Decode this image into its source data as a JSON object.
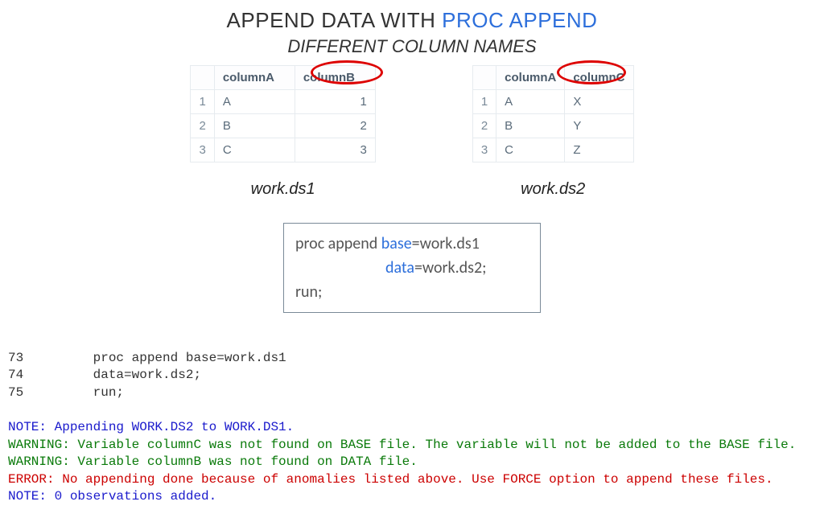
{
  "title": {
    "prefix": "APPEND DATA WITH ",
    "keyword": "PROC APPEND"
  },
  "subtitle": "DIFFERENT COLUMN NAMES",
  "table1": {
    "caption": "work.ds1",
    "headers": [
      "columnA",
      "columnB"
    ],
    "rows": [
      {
        "n": "1",
        "a": "A",
        "b": "1"
      },
      {
        "n": "2",
        "a": "B",
        "b": "2"
      },
      {
        "n": "3",
        "a": "C",
        "b": "3"
      }
    ]
  },
  "table2": {
    "caption": "work.ds2",
    "headers": [
      "columnA",
      "columnC"
    ],
    "rows": [
      {
        "n": "1",
        "a": "A",
        "b": "X"
      },
      {
        "n": "2",
        "a": "B",
        "b": "Y"
      },
      {
        "n": "3",
        "a": "C",
        "b": "Z"
      }
    ]
  },
  "codebox": {
    "w1": "proc append ",
    "kw1": "base",
    "w2": "=work.ds1",
    "kw2": "data",
    "w3": "=work.ds2;",
    "w4": "run;"
  },
  "log": {
    "l1": "73         proc append base=work.ds1",
    "l2": "74         data=work.ds2;",
    "l3": "75         run;",
    "note1": "NOTE: Appending WORK.DS2 to WORK.DS1.",
    "warn1": "WARNING: Variable columnC was not found on BASE file. The variable will not be added to the BASE file.",
    "warn2": "WARNING: Variable columnB was not found on DATA file.",
    "err1": "ERROR: No appending done because of anomalies listed above. Use FORCE option to append these files.",
    "note2": "NOTE: 0 observations added."
  }
}
